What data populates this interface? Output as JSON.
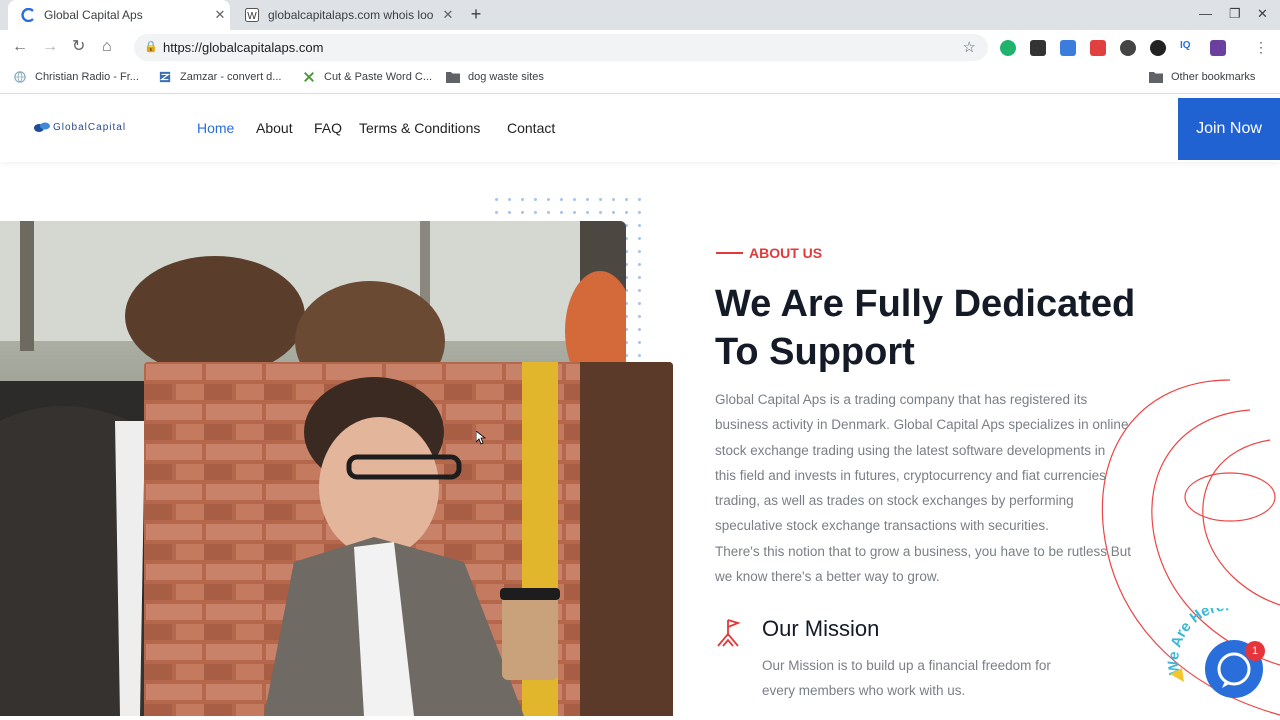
{
  "browser": {
    "tabs": [
      {
        "title": "Global Capital Aps",
        "active": true,
        "icon": "site-favicon"
      },
      {
        "title": "globalcapitalaps.com whois loo",
        "active": false,
        "icon": "w-favicon"
      }
    ],
    "url": "https://globalcapitalaps.com",
    "bookmarks": [
      {
        "label": "Christian Radio - Fr...",
        "icon": "globe-icon"
      },
      {
        "label": "Zamzar - convert d...",
        "icon": "zamzar-icon"
      },
      {
        "label": "Cut & Paste Word C...",
        "icon": "puzzle-icon"
      },
      {
        "label": "dog waste sites",
        "icon": "folder-icon"
      }
    ],
    "other_bookmarks": "Other bookmarks"
  },
  "site": {
    "logo_text": "GlobalCapital",
    "nav": [
      "Home",
      "About",
      "FAQ",
      "Terms & Conditions",
      "Contact"
    ],
    "active_nav": "Home",
    "join_label": "Join Now",
    "about_tag": "ABOUT US",
    "headline_line1": "We Are Fully Dedicated",
    "headline_line2": "To Support",
    "body_lines": [
      "Global Capital Aps is a trading company that has registered its",
      "business activity in Denmark. Global Capital Aps specializes in online",
      "stock exchange trading using the latest software developments in",
      "this field and invests in futures, cryptocurrency and fiat currencies",
      "trading, as well as trades on stock exchanges by performing",
      "speculative stock exchange transactions with securities.",
      "There's this notion that to grow a business, you have to be rutless But",
      "we know there's a better way to grow."
    ],
    "mission_title": "Our Mission",
    "mission_lines": [
      "Our Mission is to build up a financial freedom for",
      "every members who work with us."
    ],
    "chat_badge_text": "We Are Here!",
    "chat_count": "1"
  },
  "colors": {
    "accent_blue": "#2162d3",
    "accent_red": "#e23a3a",
    "heading": "#141a26"
  }
}
